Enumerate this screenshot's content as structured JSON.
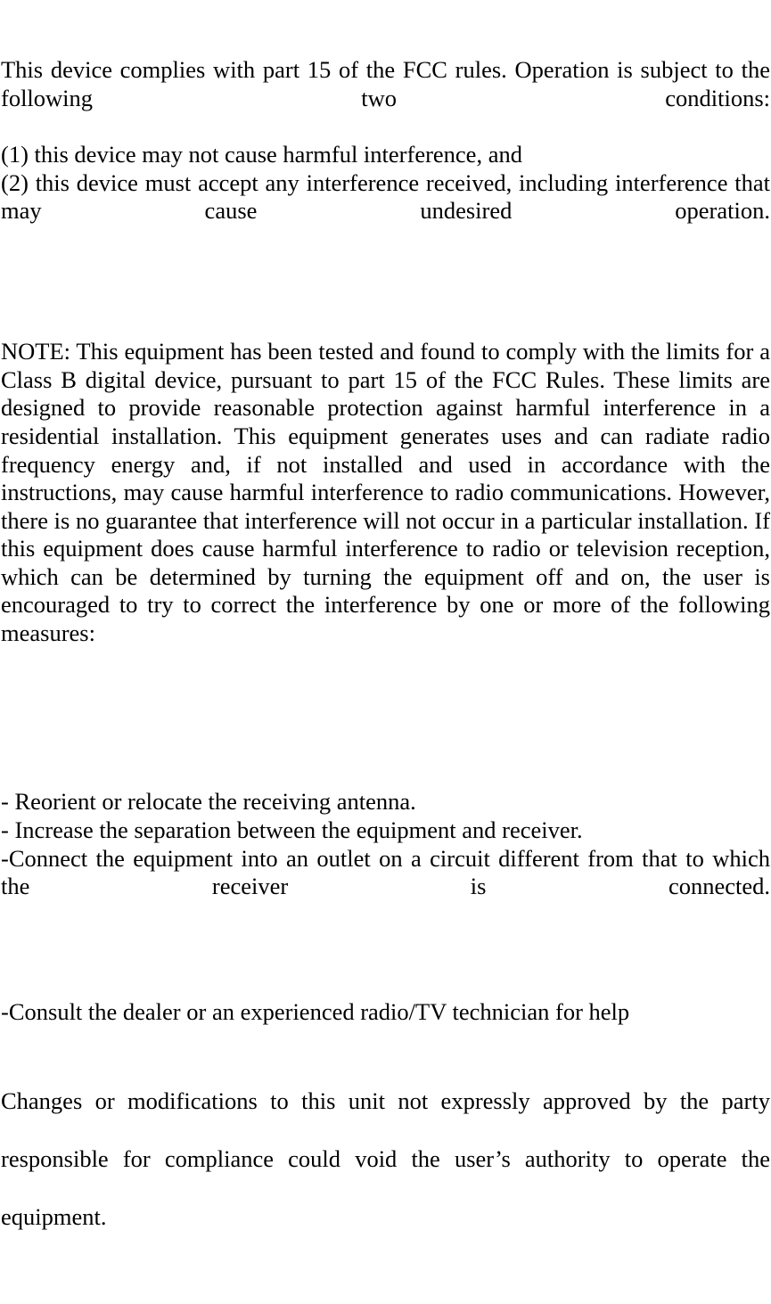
{
  "document": {
    "type": "fcc-compliance-statement",
    "paragraphs": {
      "compliance": {
        "line1": "This device complies with part 15 of the FCC rules. Operation is subject to the following two conditions:",
        "line2": "(1) this device may not cause harmful interference, and",
        "line3": "(2) this device must accept any interference received, including interference that may cause undesired operation."
      },
      "note": "NOTE: This equipment has been tested and found to comply with the limits for a Class B digital device, pursuant to part 15 of the FCC Rules. These limits are designed to provide reasonable protection against harmful interference in a residential installation. This equipment generates uses and can radiate radio frequency energy and, if not installed and used in accordance with the instructions, may cause harmful interference to radio communications. However, there is no guarantee that interference will not occur in a particular installation. If this equipment does cause harmful interference to radio or television reception, which can be determined by turning the equipment off and on, the user is encouraged to try to correct the interference by one or more of the following measures:",
      "measures": {
        "item1": "- Reorient or relocate the receiving antenna.",
        "item2": "- Increase the separation between the equipment and receiver.",
        "item3": "-Connect the equipment into an outlet on a circuit different from that to which the receiver is connected.",
        "item4": "-Consult the dealer or an experienced radio/TV technician for help"
      },
      "changes": "Changes or modifications to this unit not expressly approved by the party responsible for compliance could void the user’s authority to operate the equipment."
    }
  }
}
